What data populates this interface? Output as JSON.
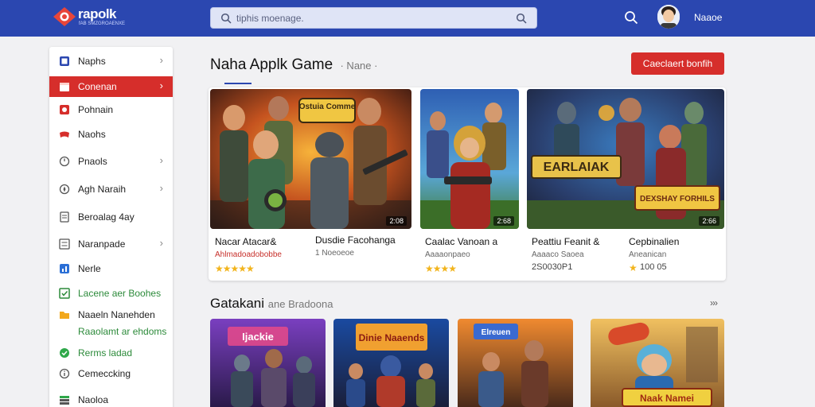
{
  "app": {
    "logo_text": "rapolk",
    "logo_sub": "fAB SMZGROAENXE"
  },
  "header": {
    "search_placeholder": "tiphis moenage.",
    "user_name": "Naaoe"
  },
  "sidebar": {
    "items": [
      {
        "label": "Naphs",
        "icon": "grid-icon",
        "chevron": true
      },
      {
        "label": "Conenan",
        "icon": "calendar-icon",
        "chevron": true,
        "active": true
      },
      {
        "label": "Pohnain",
        "icon": "gamepad-icon",
        "chevron": false
      },
      {
        "label": "Naohs",
        "icon": "controller-icon",
        "chevron": false
      },
      {
        "label": "Pnaols",
        "icon": "clock-icon",
        "chevron": true
      },
      {
        "label": "Agh Naraih",
        "icon": "compass-icon",
        "chevron": true
      },
      {
        "label": "Beroalag 4ay",
        "icon": "document-icon",
        "chevron": false
      },
      {
        "label": "Naranpade",
        "icon": "list-icon",
        "chevron": true
      },
      {
        "label": "Nerle",
        "icon": "chart-icon",
        "chevron": false
      },
      {
        "label": "Lacene aer Boohes",
        "icon": "checklist-icon",
        "chevron": false,
        "green": true
      },
      {
        "label": "Naaeln Nanehden",
        "icon": "folder-icon",
        "chevron": false
      }
    ],
    "sub_label": "Raaolamt ar ehdoms",
    "items2": [
      {
        "label": "Rerms ladad",
        "icon": "check-circle-icon",
        "green": true
      },
      {
        "label": "Cemeccking",
        "icon": "info-icon"
      },
      {
        "label": "Naoloa",
        "icon": "stack-icon"
      }
    ]
  },
  "main": {
    "title": "Naha Applk Game",
    "title_sub": "· Nane ·",
    "cta_label": "Caeclaert bonfih",
    "featured": [
      {
        "name": "Nacar Atacar&",
        "meta": "Ahlmadoadobobbe",
        "meta_red": true,
        "badge": "2:08",
        "rating": "★★★★★",
        "extra": ""
      },
      {
        "name": "Dusdie Facohanga",
        "meta": "1 Noeoeoe",
        "meta_red": false,
        "badge": "",
        "rating": "",
        "extra": ""
      },
      {
        "name": "Caalac Vanoan a",
        "meta": "Aaaaonpaeo",
        "meta_red": false,
        "badge": "2:68",
        "rating": "★★★★",
        "extra": ""
      },
      {
        "name": "Peattiu Feanit &",
        "meta": "Aaaaco Saoea",
        "meta_red": false,
        "badge": "",
        "rating": "",
        "extra": "2S0030P1"
      },
      {
        "name": "Cepbinalien",
        "meta": "Aneanican",
        "meta_red": false,
        "badge": "2:66",
        "rating": "★",
        "extra": "100 05"
      }
    ],
    "art_text": {
      "banner1": "Ostuia Comme",
      "banner2": "EARLAIAK",
      "banner3": "DEXSHAY FORHILS"
    },
    "section_title": "Gatakani",
    "section_sub": "ane Bradoona",
    "more_label": "›››",
    "thumbs_text": [
      "Ijackie",
      "Dinie Naaends",
      "Elreuen",
      "Naak Namei"
    ]
  }
}
